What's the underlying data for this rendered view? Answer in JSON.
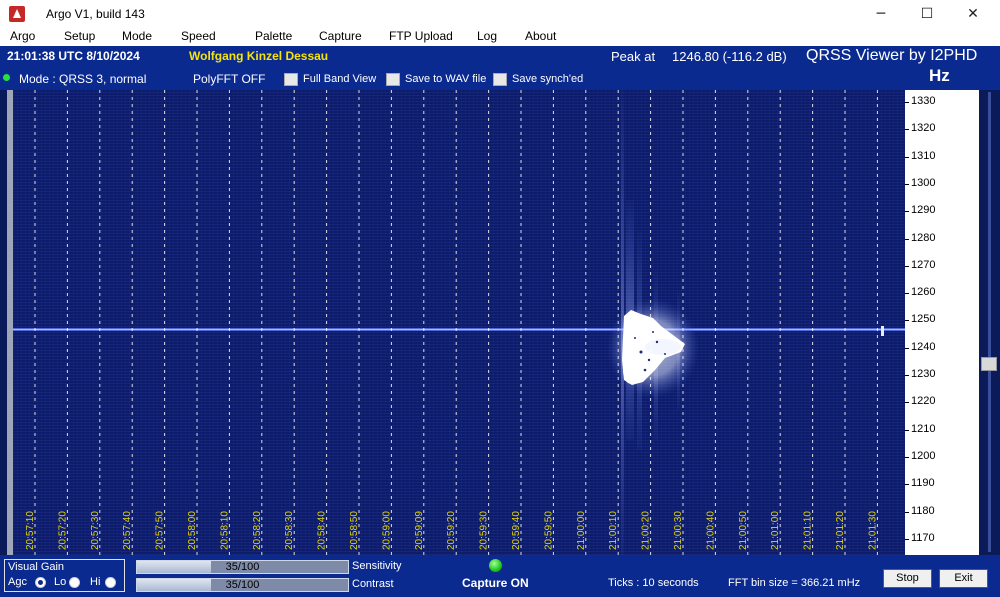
{
  "window": {
    "title": "Argo V1, build 143",
    "controls": [
      "─",
      "☐",
      "✕"
    ]
  },
  "menu": [
    "Argo",
    "Setup",
    "Mode",
    "Speed",
    "Palette",
    "Capture",
    "FTP Upload",
    "Log",
    "About"
  ],
  "header": {
    "clock": "21:01:38 UTC  8/10/2024",
    "station": "Wolfgang Kinzel Dessau",
    "peak_label": "Peak at",
    "peak_value": "1246.80 (-116.2 dB)",
    "brand": "QRSS Viewer by I2PHD",
    "unit": "Hz",
    "mode": "Mode : QRSS 3, normal",
    "polyfft": "PolyFFT OFF",
    "checkboxes": [
      "Full Band View",
      "Save to WAV file",
      "Save synch'ed"
    ]
  },
  "spectrogram": {
    "time_labels": [
      "20:57:10",
      "20:57:20",
      "20:57:30",
      "20:57:40",
      "20:57:50",
      "20:58:00",
      "20:58:10",
      "20:58:20",
      "20:58:30",
      "20:58:40",
      "20:58:50",
      "20:59:00",
      "20:59:09",
      "20:59:20",
      "20:59:30",
      "20:59:40",
      "20:59:50",
      "21:00:00",
      "21:00:10",
      "21:00:20",
      "21:00:30",
      "21:00:40",
      "21:00:50",
      "21:01:00",
      "21:01:10",
      "21:01:20",
      "21:01:30"
    ],
    "freq_labels": [
      "1330",
      "1320",
      "1310",
      "1300",
      "1290",
      "1280",
      "1270",
      "1260",
      "1250",
      "1240",
      "1230",
      "1220",
      "1210",
      "1200",
      "1190",
      "1180",
      "1170"
    ],
    "carrier_hz": 1246.8,
    "colors": {
      "background": "#0c1c6a",
      "signal": "#ffffff",
      "grid": "#ffffff",
      "time_label": "#e3d50a"
    }
  },
  "bottom": {
    "visual_gain": {
      "title": "Visual Gain",
      "options": [
        "Agc",
        "Lo",
        "Hi"
      ],
      "selected": "Agc"
    },
    "sensitivity": {
      "label": "Sensitivity",
      "value": "35/100",
      "fraction": 0.35
    },
    "contrast": {
      "label": "Contrast",
      "value": "35/100",
      "fraction": 0.35
    },
    "capture": "Capture ON",
    "ticks": "Ticks  :  10 seconds",
    "fft_bin": "FFT bin size = 366.21 mHz",
    "buttons": {
      "stop": "Stop",
      "exit": "Exit"
    }
  }
}
